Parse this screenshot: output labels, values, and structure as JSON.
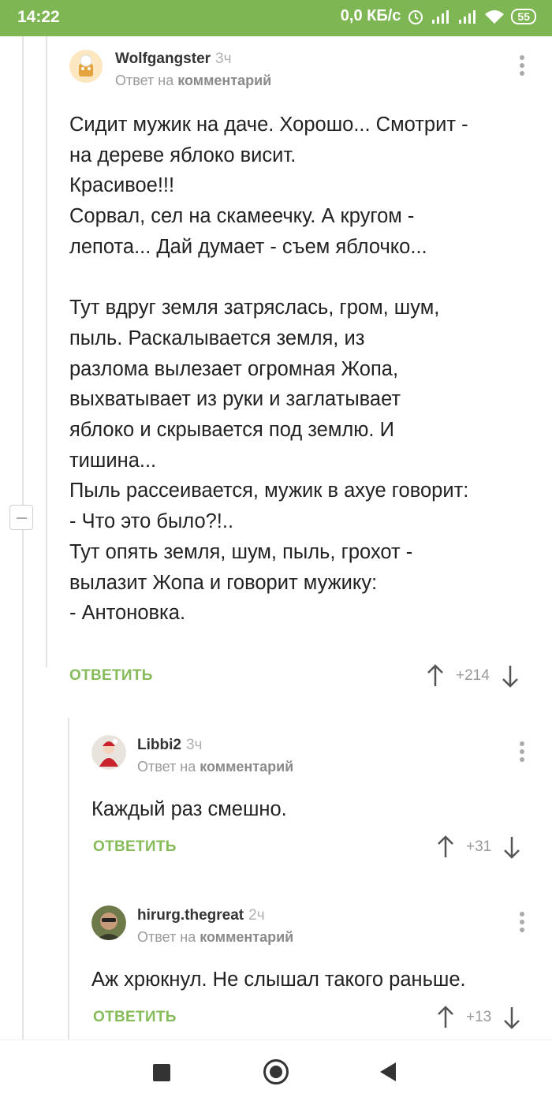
{
  "status_bar": {
    "time": "14:22",
    "network_speed": "0,0 КБ/с",
    "battery": "55"
  },
  "comments": [
    {
      "author": "Wolfgangster",
      "time": "3ч",
      "reply_prefix": "Ответ на",
      "reply_target": "комментарий",
      "text": "Сидит мужик на даче. Хорошо... Смотрит -\nна дереве яблоко висит.\nКрасивое!!!\nСорвал, сел на скамеечку. А кругом -\nлепота... Дай думает - съем яблочко...\n\nТут вдруг земля затряслась, гром, шум,\nпыль. Раскалывается земля, из\nразлома вылезает огромная Жопа,\nвыхватывает из руки и заглатывает\nяблоко и скрывается под землю. И\nтишина...\nПыль рассеивается, мужик в ахуе говорит:\n- Что это было?!..\nТут опять земля, шум, пыль, грохот -\nвылазит Жопа и говорит мужику:\n- Антоновка.",
      "reply_label": "ОТВЕТИТЬ",
      "score": "+214"
    },
    {
      "author": "Libbi2",
      "time": "3ч",
      "reply_prefix": "Ответ на",
      "reply_target": "комментарий",
      "text": "Каждый раз смешно.",
      "reply_label": "ОТВЕТИТЬ",
      "score": "+31"
    },
    {
      "author": "hirurg.thegreat",
      "time": "2ч",
      "reply_prefix": "Ответ на",
      "reply_target": "комментарий",
      "text": "Аж хрюкнул. Не слышал такого раньше.",
      "reply_label": "ОТВЕТИТЬ",
      "score": "+13"
    }
  ],
  "colors": {
    "status_bar": "#7eb654",
    "accent_green": "#86bb5a"
  }
}
